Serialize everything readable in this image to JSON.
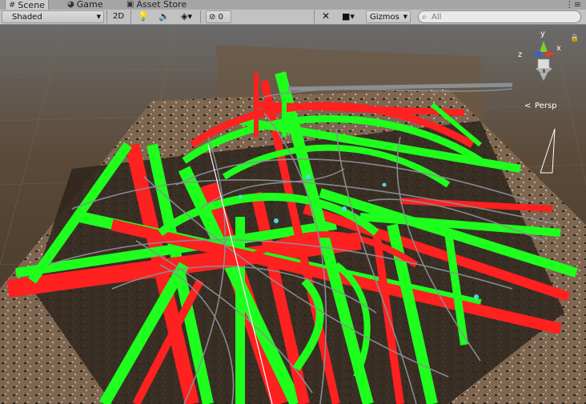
{
  "tabs": [
    {
      "icon": "grid-icon",
      "label": "Scene",
      "active": true
    },
    {
      "icon": "pacman-icon",
      "label": "Game",
      "active": false
    },
    {
      "icon": "store-bag-icon",
      "label": "Asset Store",
      "active": false
    }
  ],
  "window_menu_glyph": "⋮≡",
  "toolbar": {
    "shading_mode": "Shaded",
    "mode_2d": "2D",
    "hidden_count": "0",
    "gizmos_label": "Gizmos",
    "search_placeholder": "All"
  },
  "scene_gizmo": {
    "axis_y": "y",
    "axis_x": "x",
    "axis_z": "z",
    "projection_label": "Persp"
  },
  "colors": {
    "road_red": "#ff2020",
    "road_green": "#1eff1e",
    "spline_gray": "#8a8f96",
    "ground": "#5a4632",
    "axis_x": "#e0402a",
    "axis_y": "#7bd02a",
    "axis_z": "#3a5fd0"
  }
}
